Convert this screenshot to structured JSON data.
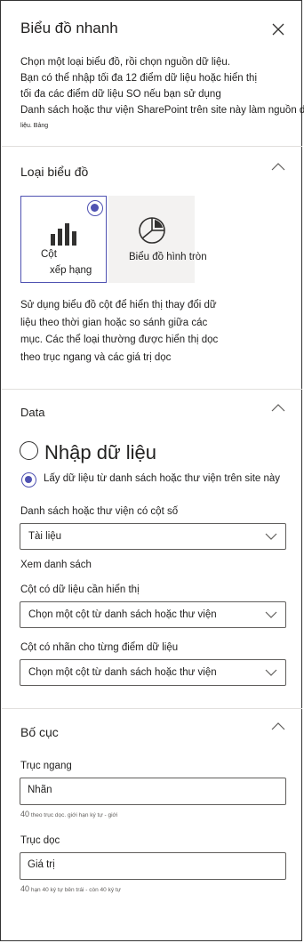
{
  "panel": {
    "title": "Biểu đồ nhanh",
    "intro": [
      "Chọn một loại biểu đồ, rồi chọn nguồn dữ liệu.",
      "Bạn có thể nhập tối đa 12 điểm dữ liệu hoặc hiển thị",
      "tối đa các điểm dữ liệu SO nếu bạn sử dụng",
      "Danh sách hoặc thư viện SharePoint trên site này làm nguồn dữ"
    ],
    "intro_small": "liệu. Bảng"
  },
  "chart_type": {
    "title": "Loại biểu đồ",
    "options": [
      {
        "label_line1": "Cột",
        "label_line2": "xếp hạng",
        "icon": "bar-chart-icon",
        "selected": true
      },
      {
        "label": "Biểu đồ hình tròn",
        "icon": "pie-chart-icon",
        "selected": false
      }
    ],
    "description": [
      "Sử dụng biểu đồ cột để hiển thị thay đổi dữ",
      "liệu theo thời gian hoặc so sánh giữa các",
      "mục. Các thể loại thường được hiển thị dọc",
      "theo trục ngang và các giá trị dọc"
    ]
  },
  "data": {
    "title": "Data",
    "radio_manual": "Nhập dữ liệu",
    "radio_list": "Lấy dữ liệu từ danh sách hoặc thư viện trên site này",
    "selected_source": "list",
    "list_label": "Danh sách hoặc thư viện có cột số",
    "list_value": "Tài liệu",
    "view_list_link": "Xem danh sách",
    "data_column_label": "Cột có dữ liệu cần hiển thị",
    "data_column_value": "Chọn một cột từ danh sách hoặc thư viện",
    "label_column_label": "Cột có nhãn cho từng điểm dữ liệu",
    "label_column_value": "Chọn một cột từ danh sách hoặc thư viện"
  },
  "layout": {
    "title": "Bố cục",
    "x_axis_label": "Trục ngang",
    "x_axis_value": "Nhãn",
    "x_hint_num": "40",
    "x_hint_text": "theo trục dọc. giới hạn ký tự - giới",
    "y_axis_label": "Trục dọc",
    "y_axis_value": "Giá trị",
    "y_hint_num": "40",
    "y_hint_text": "hạn 40 ký tự bên trái - còn 40 ký tự"
  },
  "colors": {
    "accent": "#4f52b2",
    "border": "#605e5c",
    "divider": "#e1dfdd",
    "tile_bg": "#f3f2f1"
  }
}
